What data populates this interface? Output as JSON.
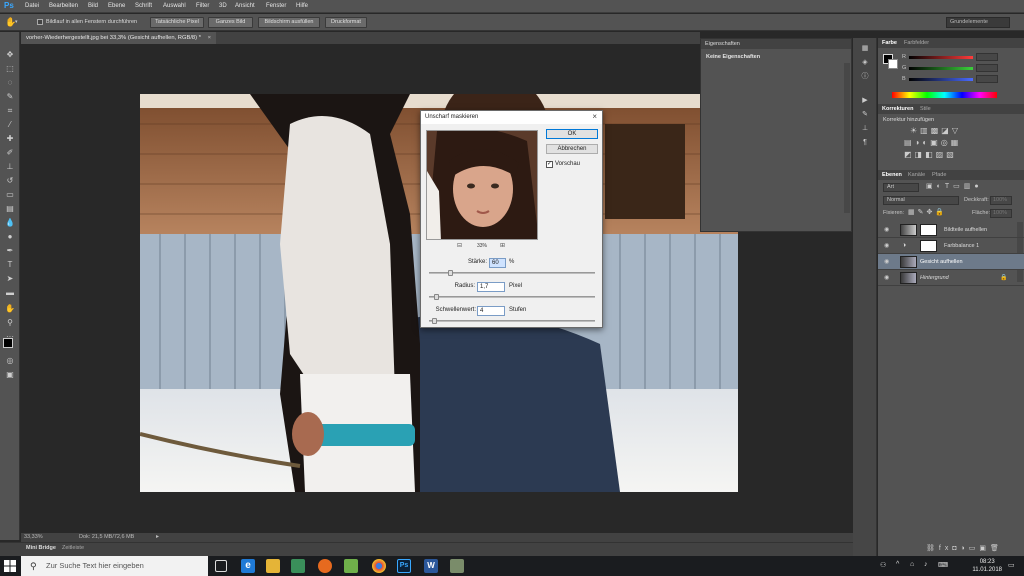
{
  "app": {
    "logo": "Ps",
    "brand_color": "#39a8ff"
  },
  "menu": [
    "Datei",
    "Bearbeiten",
    "Bild",
    "Ebene",
    "Schrift",
    "Auswahl",
    "Filter",
    "3D",
    "Ansicht",
    "Fenster",
    "Hilfe"
  ],
  "options_bar": {
    "checkbox_label": "Bildlauf in allen Fenstern durchführen",
    "buttons": [
      "Tatsächliche Pixel",
      "Ganzes Bild",
      "Bildschirm ausfüllen",
      "Druckformat"
    ],
    "workspace": "Grundelemente"
  },
  "document": {
    "tab_title": "vorher-Wiederhergestellt.jpg bei 33,3% (Gesicht aufhellen, RGB/8) *",
    "zoom": "33,33%",
    "doc_size": "Dok: 21,5 MB/72,6 MB"
  },
  "bottom_tabs": [
    "Mini Bridge",
    "Zeitleiste"
  ],
  "properties_panel": {
    "tab": "Eigenschaften",
    "message": "Keine Eigenschaften"
  },
  "color_panel": {
    "tabs": [
      "Farbe",
      "Farbfelder"
    ],
    "channels": [
      {
        "label": "R",
        "color": "#ff3b3b"
      },
      {
        "label": "G",
        "color": "#3bd13b"
      },
      {
        "label": "B",
        "color": "#4a6bff"
      }
    ]
  },
  "adjustments_panel": {
    "tabs": [
      "Korrekturen",
      "Stile"
    ],
    "heading": "Korrektur hinzufügen"
  },
  "layers_panel": {
    "tabs": [
      "Ebenen",
      "Kanäle",
      "Pfade"
    ],
    "kind": "Art",
    "blend_mode": "Normal",
    "opacity_label": "Deckkraft:",
    "opacity_value": "100%",
    "lock_label": "Fixieren:",
    "fill_label": "Fläche:",
    "fill_value": "100%",
    "layers": [
      {
        "name": "Bildteile aufhellen"
      },
      {
        "name": "Farbbalance 1"
      },
      {
        "name": "Gesicht aufhellen"
      },
      {
        "name": "Hintergrund"
      }
    ]
  },
  "dialog": {
    "title": "Unscharf maskieren",
    "ok": "OK",
    "cancel": "Abbrechen",
    "preview_label": "Vorschau",
    "preview_checked": true,
    "preview_zoom": "33%",
    "fields": [
      {
        "label": "Stärke:",
        "value": "60",
        "unit": "%",
        "level": 0.12
      },
      {
        "label": "Radius:",
        "value": "1,7",
        "unit": "Pixel",
        "level": 0.03
      },
      {
        "label": "Schwellenwert:",
        "value": "4",
        "unit": "Stufen",
        "level": 0.02
      }
    ]
  },
  "taskbar": {
    "search_placeholder": "Zur Suche Text hier eingeben",
    "time": "08:23",
    "date": "11.01.2018"
  }
}
